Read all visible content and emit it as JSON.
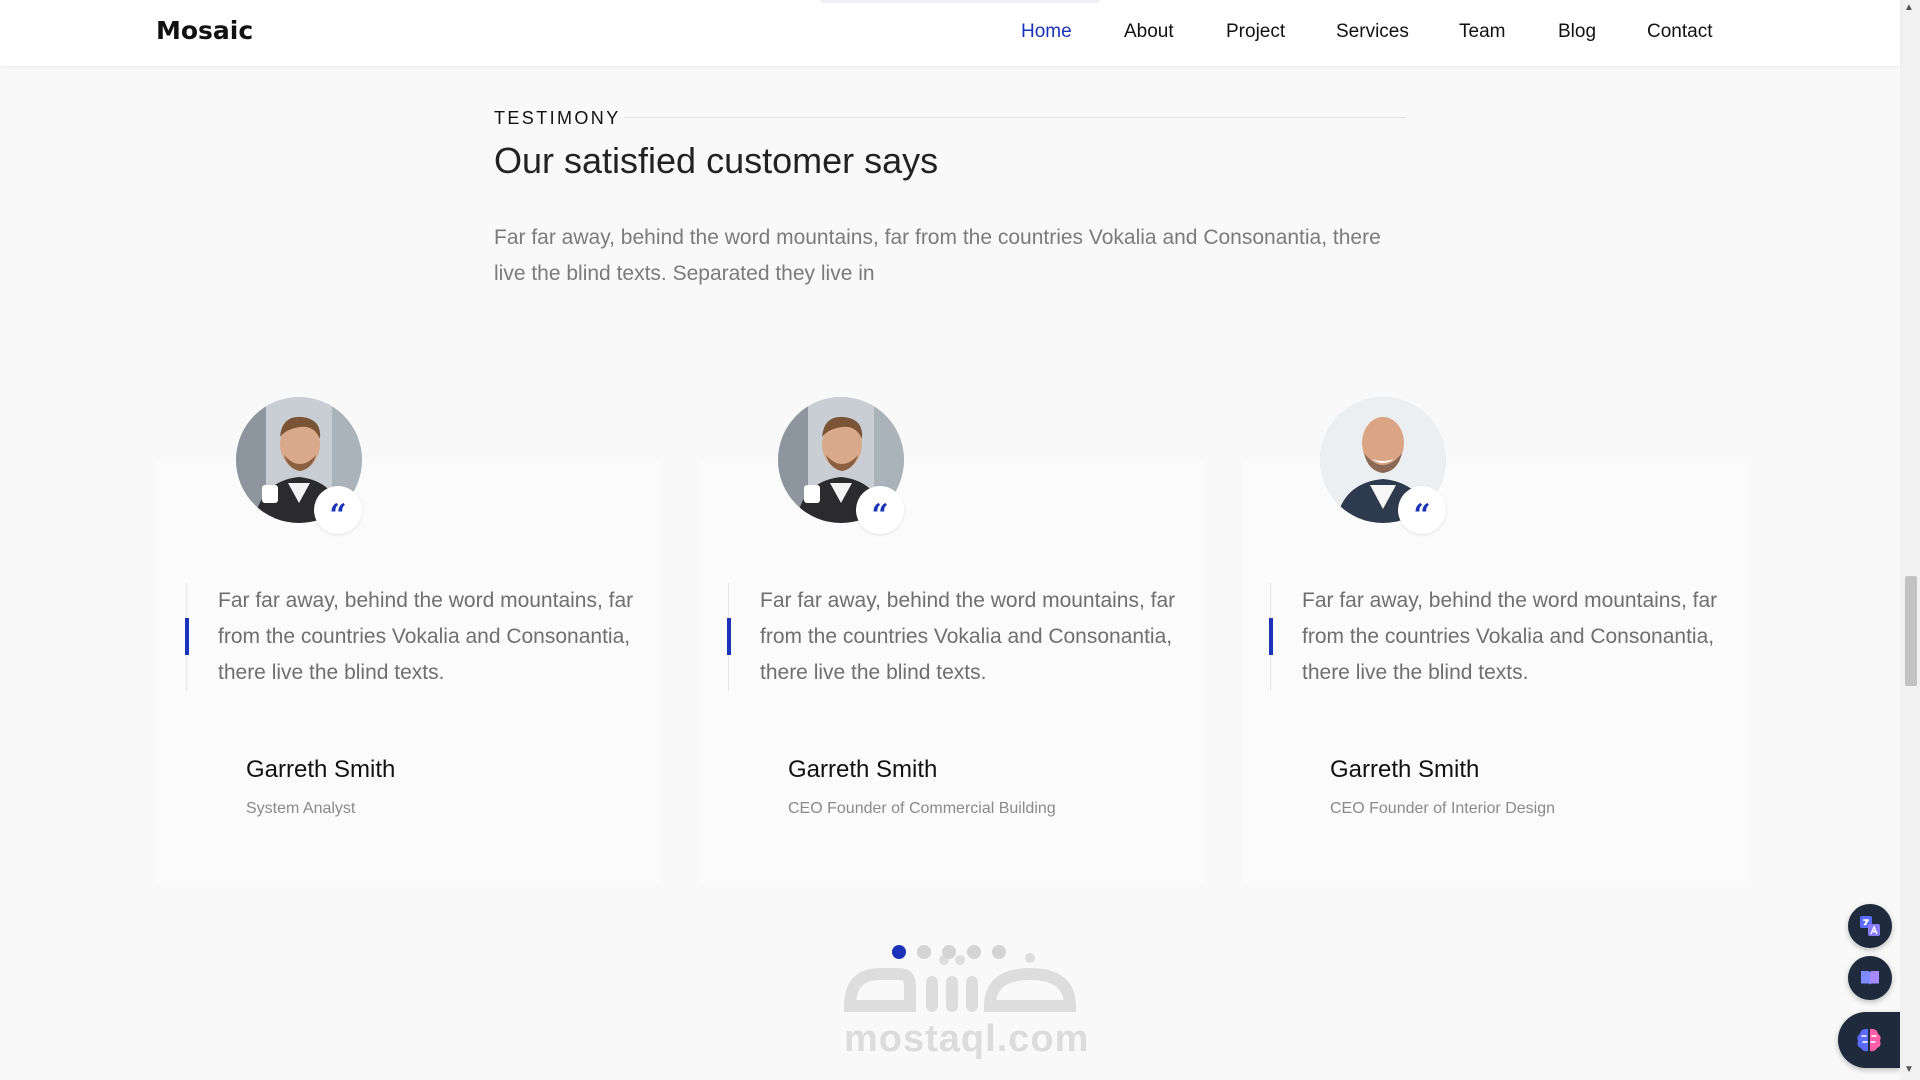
{
  "brand": "Mosaic",
  "nav": {
    "items": [
      {
        "label": "Home",
        "active": true
      },
      {
        "label": "About",
        "active": false
      },
      {
        "label": "Project",
        "active": false
      },
      {
        "label": "Services",
        "active": false
      },
      {
        "label": "Team",
        "active": false
      },
      {
        "label": "Blog",
        "active": false
      },
      {
        "label": "Contact",
        "active": false
      }
    ]
  },
  "section": {
    "eyebrow": "TESTIMONY",
    "title": "Our satisfied customer says",
    "description": "Far far away, behind the word mountains, far from the countries Vokalia and Consonantia, there live the blind texts. Separated they live in"
  },
  "testimonials": [
    {
      "quote": "Far far away, behind the word mountains, far from the countries Vokalia and Consonantia, there live the blind texts.",
      "name": "Garreth Smith",
      "role": "System Analyst",
      "quote_glyph": "“"
    },
    {
      "quote": "Far far away, behind the word mountains, far from the countries Vokalia and Consonantia, there live the blind texts.",
      "name": "Garreth Smith",
      "role": "CEO Founder of Commercial Building",
      "quote_glyph": "“"
    },
    {
      "quote": "Far far away, behind the word mountains, far from the countries Vokalia and Consonantia, there live the blind texts.",
      "name": "Garreth Smith",
      "role": "CEO Founder of Interior Design",
      "quote_glyph": "“"
    }
  ],
  "carousel": {
    "dot_count": 5,
    "active_index": 0
  },
  "watermark": {
    "text": "mostaql.com",
    "arabic": "مستقل"
  },
  "colors": {
    "accent": "#1a33b8",
    "fab": "#1f2a3c"
  },
  "icons": [
    "quote-icon",
    "translate-icon",
    "reader-icon",
    "brain-icon"
  ]
}
